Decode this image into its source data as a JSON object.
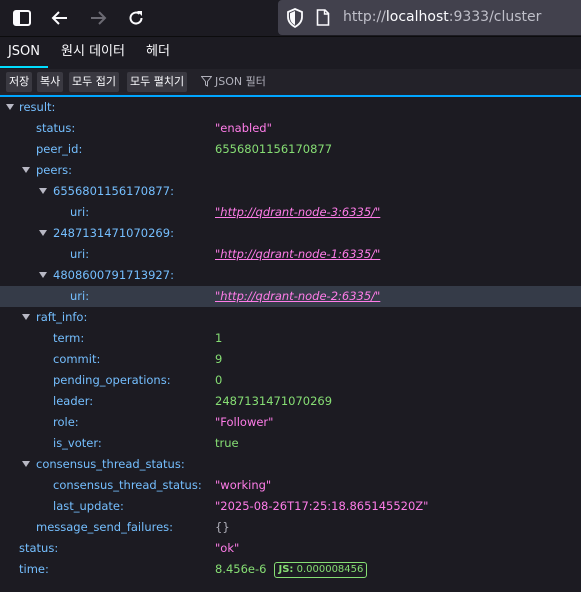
{
  "browser": {
    "url_prefix": "http://",
    "url_host": "localhost",
    "url_rest": ":9333/cluster"
  },
  "tabs": [
    {
      "label": "JSON",
      "active": true
    },
    {
      "label": "원시 데이터",
      "active": false
    },
    {
      "label": "헤더",
      "active": false
    }
  ],
  "actions": {
    "save": "저장",
    "copy": "복사",
    "collapse_all": "모두 접기",
    "expand_all": "모두 펼치기",
    "filter_placeholder": "JSON 필터"
  },
  "tree": {
    "result_key": "result",
    "status_key": "status",
    "status_val": "\"enabled\"",
    "peer_id_key": "peer_id",
    "peer_id_val": "6556801156170877",
    "peers_key": "peers",
    "peer1_key": "6556801156170877",
    "peer1_uri_key": "uri",
    "peer1_uri_val": "\"http://qdrant-node-3:6335/\"",
    "peer2_key": "2487131471070269",
    "peer2_uri_key": "uri",
    "peer2_uri_val": "\"http://qdrant-node-1:6335/\"",
    "peer3_key": "4808600791713927",
    "peer3_uri_key": "uri",
    "peer3_uri_val": "\"http://qdrant-node-2:6335/\"",
    "raft_info_key": "raft_info",
    "term_key": "term",
    "term_val": "1",
    "commit_key": "commit",
    "commit_val": "9",
    "pending_key": "pending_operations",
    "pending_val": "0",
    "leader_key": "leader",
    "leader_val": "2487131471070269",
    "role_key": "role",
    "role_val": "\"Follower\"",
    "is_voter_key": "is_voter",
    "is_voter_val": "true",
    "consensus_key": "consensus_thread_status",
    "cts_key": "consensus_thread_status",
    "cts_val": "\"working\"",
    "last_update_key": "last_update",
    "last_update_val": "\"2025-08-26T17:25:18.865145520Z\"",
    "msg_fail_key": "message_send_failures",
    "msg_fail_val": "{}",
    "top_status_key": "status",
    "top_status_val": "\"ok\"",
    "time_key": "time",
    "time_val": "8.456e-6",
    "time_js_label": "JS:",
    "time_js_val": "0.000008456"
  }
}
